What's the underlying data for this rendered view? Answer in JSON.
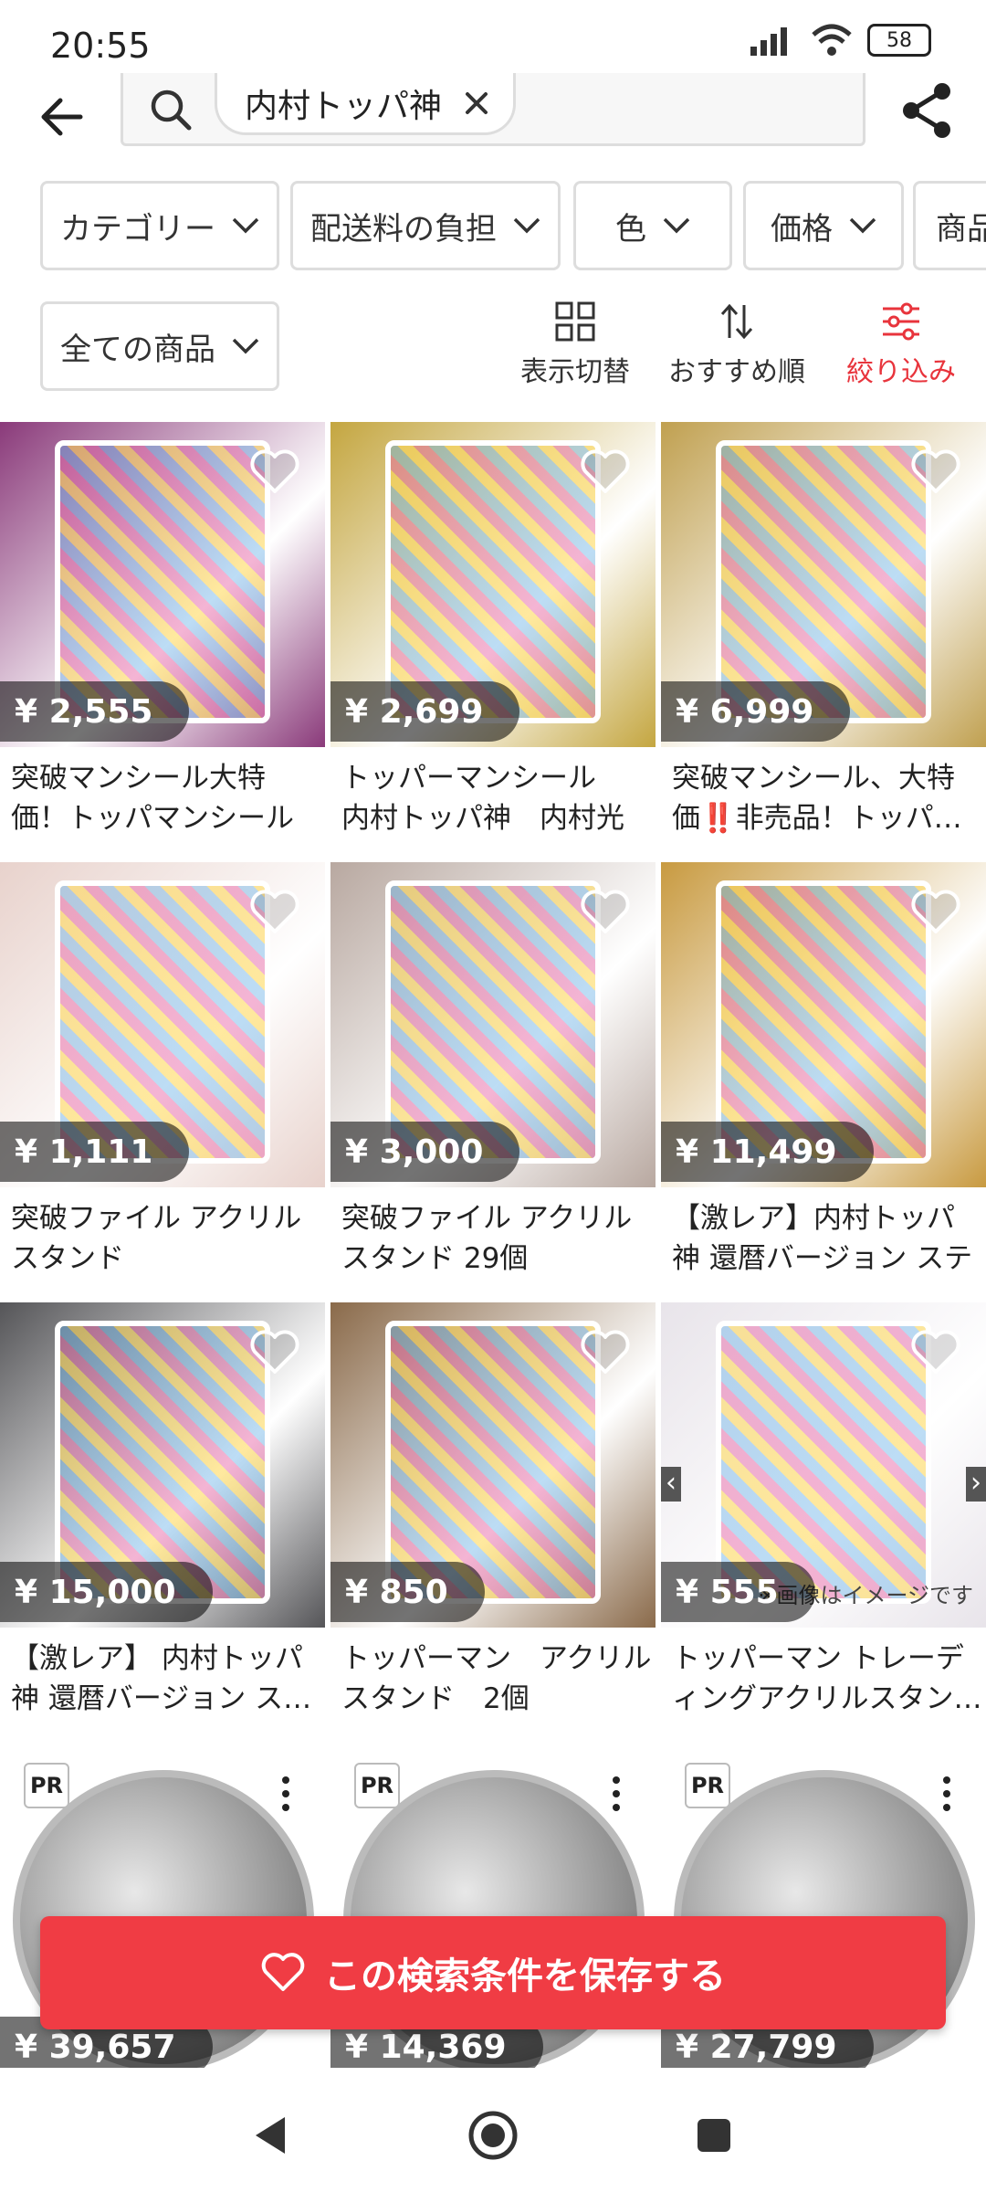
{
  "status": {
    "time": "20:55",
    "battery": "58"
  },
  "search": {
    "query": "内村トッパ神"
  },
  "filters": [
    "カテゴリー",
    "配送料の負担",
    "色",
    "価格",
    "商品"
  ],
  "filter_all": "全ての商品",
  "tools": [
    {
      "label": "表示切替",
      "icon": "grid-view-icon"
    },
    {
      "label": "おすすめ順",
      "icon": "sort-icon"
    },
    {
      "label": "絞り込み",
      "icon": "filter-icon"
    }
  ],
  "products": [
    {
      "price": "¥ 2,555",
      "title": "突破マンシール大特価！トッパマンシール",
      "color": "#8a3a7a"
    },
    {
      "price": "¥ 2,699",
      "title": "トッパーマンシール　内村トッパ神　内村光良",
      "color": "#c4a640"
    },
    {
      "price": "¥ 6,999",
      "title": "突破マンシール、大特価‼️非売品！トッパ…",
      "color": "#c0a050"
    },
    {
      "price": "¥ 1,111",
      "title": "突破ファイル アクリル スタンド",
      "color": "#e8d2cc"
    },
    {
      "price": "¥ 3,000",
      "title": "突破ファイル アクリル スタンド 29個",
      "color": "#b8a8a0"
    },
    {
      "price": "¥ 11,499",
      "title": "【激レア】内村トッパ神 還暦バージョン ステッ…",
      "color": "#c89a40"
    },
    {
      "price": "¥ 15,000",
      "title": "【激レア】 内村トッパ神 還暦バージョン ス…",
      "color": "#555558"
    },
    {
      "price": "¥ 850",
      "title": "トッパーマン　アクリル スタンド　2個",
      "color": "#8a6a4a"
    },
    {
      "price": "¥ 555",
      "title": "トッパーマン トレーディングアクリルスタン…",
      "color": "#e8e4ea",
      "overlay": "※画像はイメージです"
    }
  ],
  "pr_items": [
    {
      "price": "¥ 39,657",
      "badge": "PR"
    },
    {
      "price": "¥ 14,369",
      "badge": "PR"
    },
    {
      "price": "¥ 27,799",
      "badge": "PR"
    }
  ],
  "save_button": {
    "label": "この検索条件を保存する"
  },
  "colors": {
    "accent": "#f03c44",
    "active": "#e8343c"
  }
}
